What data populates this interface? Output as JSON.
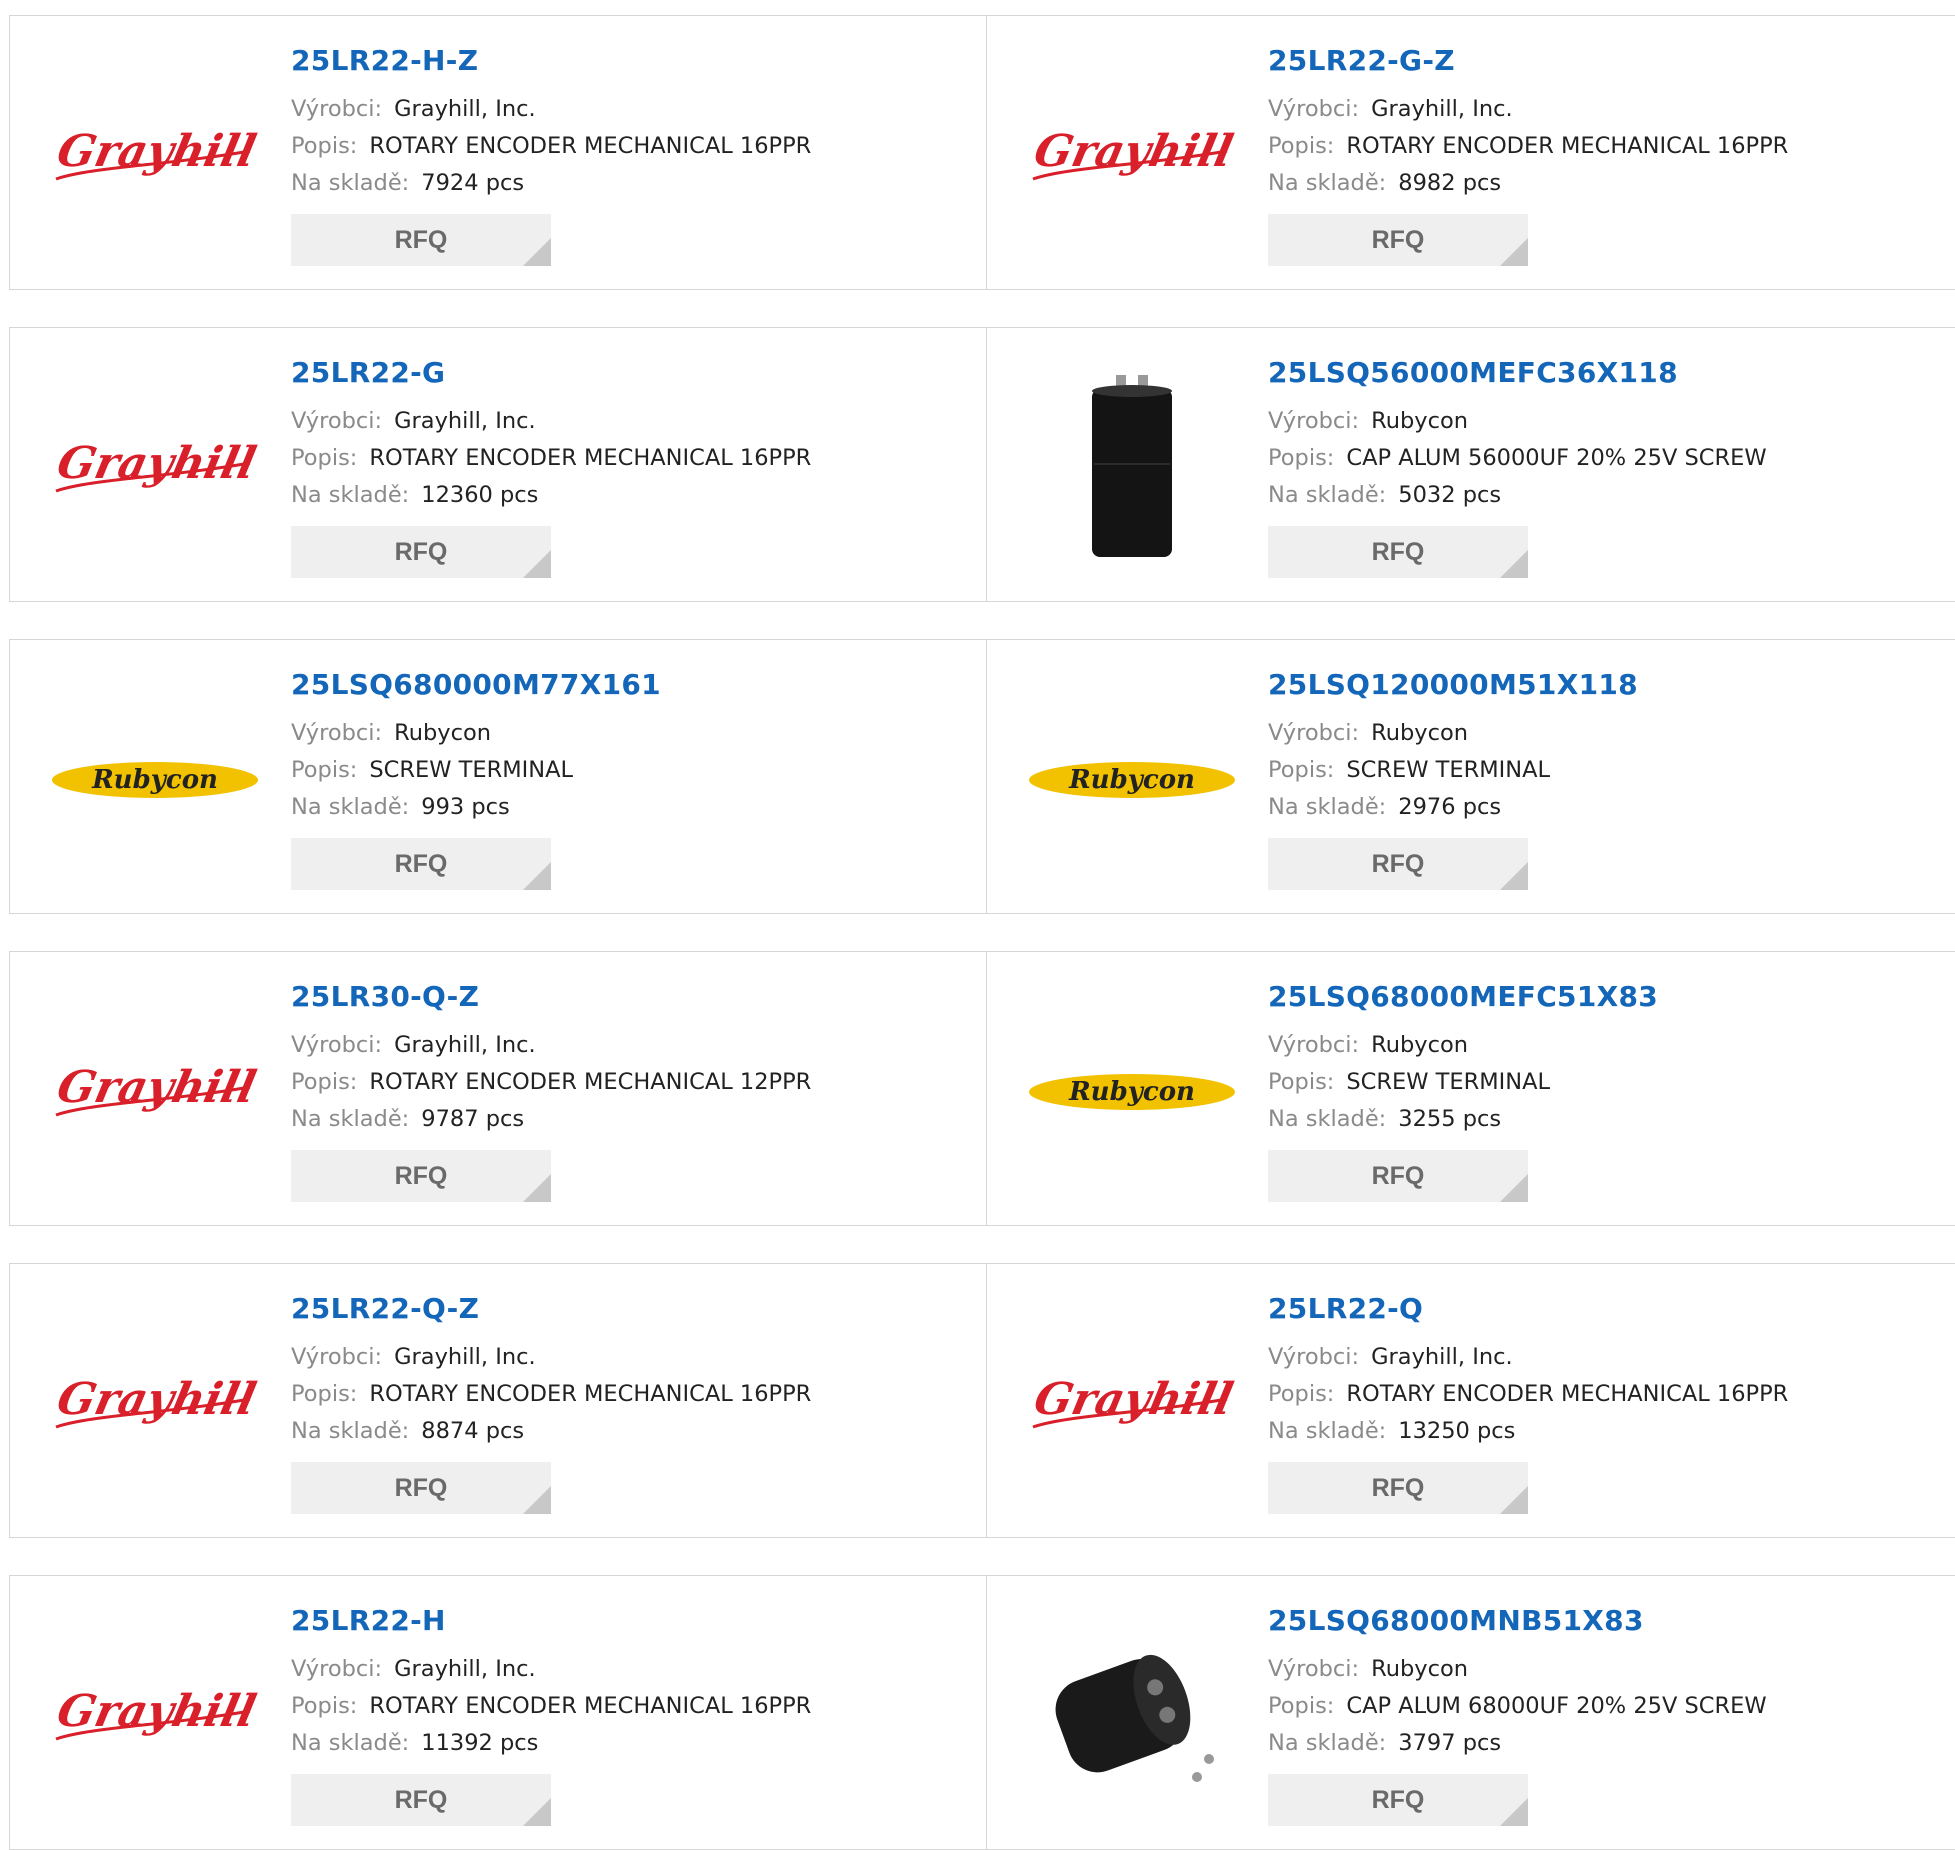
{
  "labels": {
    "manufacturer": "Výrobci:",
    "description": "Popis:",
    "stock": "Na skladě:",
    "rfq": "RFQ"
  },
  "colors": {
    "link": "#1466b8",
    "grayhill_red": "#d81f2a",
    "rubycon_yellow": "#f2c200"
  },
  "products": [
    {
      "part": "25LR22-H-Z",
      "manufacturer": "Grayhill, Inc.",
      "description": "ROTARY ENCODER MECHANICAL 16PPR",
      "stock": "7924 pcs",
      "image": "grayhill-logo"
    },
    {
      "part": "25LR22-G-Z",
      "manufacturer": "Grayhill, Inc.",
      "description": "ROTARY ENCODER MECHANICAL 16PPR",
      "stock": "8982 pcs",
      "image": "grayhill-logo"
    },
    {
      "part": "25LR22-G",
      "manufacturer": "Grayhill, Inc.",
      "description": "ROTARY ENCODER MECHANICAL 16PPR",
      "stock": "12360 pcs",
      "image": "grayhill-logo"
    },
    {
      "part": "25LSQ56000MEFC36X118",
      "manufacturer": "Rubycon",
      "description": "CAP ALUM 56000UF 20% 25V SCREW",
      "stock": "5032 pcs",
      "image": "capacitor-tall-photo"
    },
    {
      "part": "25LSQ680000M77X161",
      "manufacturer": "Rubycon",
      "description": "SCREW TERMINAL",
      "stock": "993 pcs",
      "image": "rubycon-logo"
    },
    {
      "part": "25LSQ120000M51X118",
      "manufacturer": "Rubycon",
      "description": "SCREW TERMINAL",
      "stock": "2976 pcs",
      "image": "rubycon-logo"
    },
    {
      "part": "25LR30-Q-Z",
      "manufacturer": "Grayhill, Inc.",
      "description": "ROTARY ENCODER MECHANICAL 12PPR",
      "stock": "9787 pcs",
      "image": "grayhill-logo"
    },
    {
      "part": "25LSQ68000MEFC51X83",
      "manufacturer": "Rubycon",
      "description": "SCREW TERMINAL",
      "stock": "3255 pcs",
      "image": "rubycon-logo"
    },
    {
      "part": "25LR22-Q-Z",
      "manufacturer": "Grayhill, Inc.",
      "description": "ROTARY ENCODER MECHANICAL 16PPR",
      "stock": "8874 pcs",
      "image": "grayhill-logo"
    },
    {
      "part": "25LR22-Q",
      "manufacturer": "Grayhill, Inc.",
      "description": "ROTARY ENCODER MECHANICAL 16PPR",
      "stock": "13250 pcs",
      "image": "grayhill-logo"
    },
    {
      "part": "25LR22-H",
      "manufacturer": "Grayhill, Inc.",
      "description": "ROTARY ENCODER MECHANICAL 16PPR",
      "stock": "11392 pcs",
      "image": "grayhill-logo"
    },
    {
      "part": "25LSQ68000MNB51X83",
      "manufacturer": "Rubycon",
      "description": "CAP ALUM 68000UF 20% 25V SCREW",
      "stock": "3797 pcs",
      "image": "capacitor-short-photo"
    }
  ]
}
